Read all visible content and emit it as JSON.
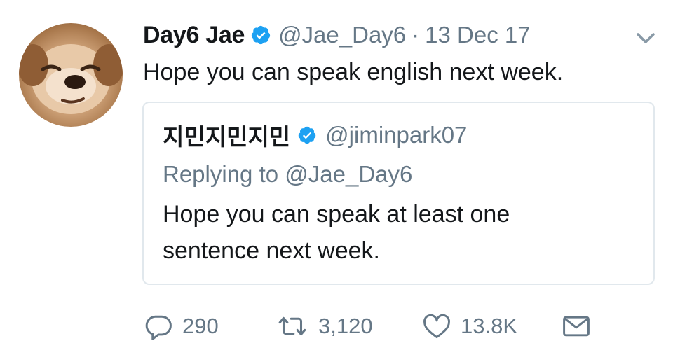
{
  "author": {
    "display_name": "Day6 Jae",
    "handle": "@Jae_Day6",
    "separator": "·",
    "date": "13 Dec 17",
    "verified": true
  },
  "tweet": {
    "text": "Hope you can speak english next week."
  },
  "quoted_tweet": {
    "display_name": "지민지민지민",
    "handle": "@jiminpark07",
    "verified": true,
    "replying_to": "Replying to @Jae_Day6",
    "text_line1": "Hope you can speak at least one",
    "text_line2": "sentence next week."
  },
  "actions": {
    "replies": "290",
    "retweets": "3,120",
    "likes": "13.8K"
  },
  "icons": {
    "verified": "verified-badge-icon",
    "menu": "chevron-down-icon",
    "reply": "reply-icon",
    "retweet": "retweet-icon",
    "like": "heart-icon",
    "dm": "envelope-icon"
  },
  "colors": {
    "text": "#14171a",
    "secondary": "#657786",
    "verified_blue": "#1da1f2",
    "border": "#e1e8ed"
  }
}
